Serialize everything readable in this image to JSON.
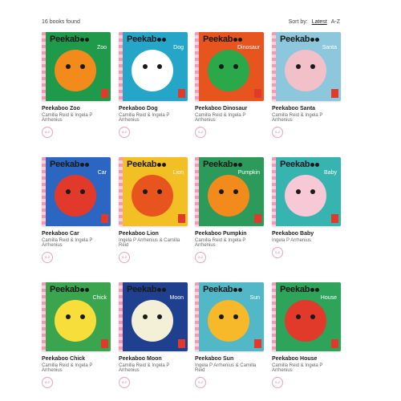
{
  "header": {
    "count": "16 books found",
    "sort_label": "Sort by:",
    "sort_latest": "Latest",
    "sort_az": "A-Z"
  },
  "books": [
    {
      "cover_word": "Peekab",
      "sub": "Zoo",
      "title": "Peekaboo Zoo",
      "authors": "Camilla Reid & Ingela P Arrhenius",
      "age": "0-2",
      "bg": "#1f9a4a",
      "art": "#f28a1c"
    },
    {
      "cover_word": "Peekab",
      "sub": "Dog",
      "title": "Peekaboo Dog",
      "authors": "Camilla Reid & Ingela P Arrhenius",
      "age": "0-2",
      "bg": "#25a6c9",
      "art": "#ffffff"
    },
    {
      "cover_word": "Peekab",
      "sub": "Dinosaur",
      "title": "Peekaboo Dinosaur",
      "authors": "Camilla Reid & Ingela P Arrhenius",
      "age": "0-2",
      "bg": "#e8541e",
      "art": "#2aa84a"
    },
    {
      "cover_word": "Peekab",
      "sub": "Santa",
      "title": "Peekaboo Santa",
      "authors": "Camilla Reid & Ingela P Arrhenius",
      "age": "0-2",
      "bg": "#8cc7dc",
      "art": "#f2c0c8"
    },
    {
      "cover_word": "Peekab",
      "sub": "Car",
      "title": "Peekaboo Car",
      "authors": "Camilla Reid & Ingela P Arrhenius",
      "age": "0-2",
      "bg": "#2b66c2",
      "art": "#e23a2a"
    },
    {
      "cover_word": "Peekab",
      "sub": "Lion",
      "title": "Peekaboo Lion",
      "authors": "Ingela P Arrhenius & Camilla Reid",
      "age": "0-2",
      "bg": "#f2c024",
      "art": "#e8541e"
    },
    {
      "cover_word": "Peekab",
      "sub": "Pumpkin",
      "title": "Peekaboo Pumpkin",
      "authors": "Camilla Reid & Ingela P Arrhenius",
      "age": "0-2",
      "bg": "#2c9a5a",
      "art": "#f28a1c"
    },
    {
      "cover_word": "Peekab",
      "sub": "Baby",
      "title": "Peekaboo Baby",
      "authors": "Ingela P Arrhenius",
      "age": "0-2",
      "bg": "#37b3b0",
      "art": "#f7c8d6"
    },
    {
      "cover_word": "Peekab",
      "sub": "Chick",
      "title": "Peekaboo Chick",
      "authors": "Camilla Reid & Ingela P Arrhenius",
      "age": "0-2",
      "bg": "#3aa44e",
      "art": "#f7de3a"
    },
    {
      "cover_word": "Peekab",
      "sub": "Moon",
      "title": "Peekaboo Moon",
      "authors": "Camilla Reid & Ingela P Arrhenius",
      "age": "0-2",
      "bg": "#1f3f8f",
      "art": "#f4f0d8"
    },
    {
      "cover_word": "Peekab",
      "sub": "Sun",
      "title": "Peekaboo Sun",
      "authors": "Ingela P Arrhenius & Camilla Reid",
      "age": "0-2",
      "bg": "#52b8c8",
      "art": "#f7b82a"
    },
    {
      "cover_word": "Peekab",
      "sub": "House",
      "title": "Peekaboo House",
      "authors": "Camilla Reid & Ingela P Arrhenius",
      "age": "0-2",
      "bg": "#2ea35a",
      "art": "#e23a2a"
    }
  ]
}
